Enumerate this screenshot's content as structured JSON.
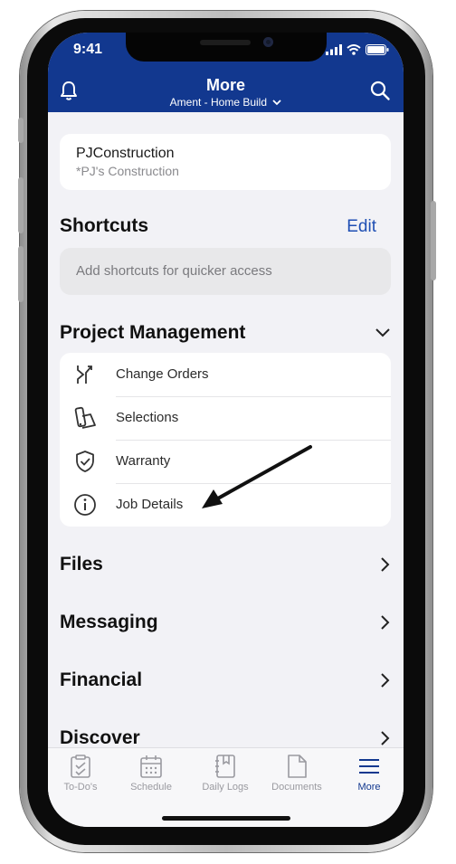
{
  "status": {
    "time": "9:41"
  },
  "header": {
    "title": "More",
    "project": "Ament - Home Build"
  },
  "company": {
    "name": "PJConstruction",
    "subtitle": "*PJ's Construction"
  },
  "shortcuts": {
    "title": "Shortcuts",
    "edit_label": "Edit",
    "placeholder": "Add shortcuts for quicker access"
  },
  "project_management": {
    "title": "Project Management",
    "items": [
      {
        "label": "Change Orders",
        "icon": "change-orders-icon"
      },
      {
        "label": "Selections",
        "icon": "selections-icon"
      },
      {
        "label": "Warranty",
        "icon": "shield-icon"
      },
      {
        "label": "Job Details",
        "icon": "info-icon"
      }
    ]
  },
  "sections": [
    {
      "title": "Files"
    },
    {
      "title": "Messaging"
    },
    {
      "title": "Financial"
    },
    {
      "title": "Discover"
    }
  ],
  "tabbar": {
    "items": [
      {
        "label": "To-Do's",
        "icon": "todo-icon"
      },
      {
        "label": "Schedule",
        "icon": "calendar-icon"
      },
      {
        "label": "Daily Logs",
        "icon": "daily-logs-icon"
      },
      {
        "label": "Documents",
        "icon": "document-icon"
      },
      {
        "label": "More",
        "icon": "menu-icon"
      }
    ],
    "active": "More"
  },
  "colors": {
    "header_bg": "#12388f",
    "accent": "#1f4fb4",
    "background": "#f2f2f6"
  }
}
